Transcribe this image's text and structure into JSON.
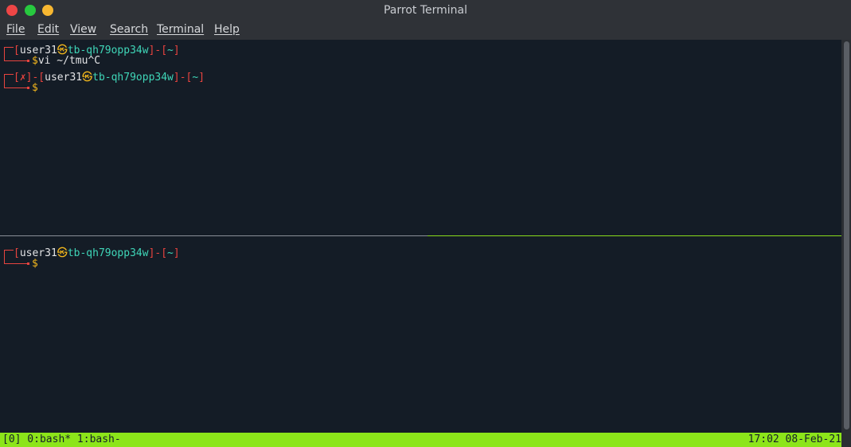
{
  "window": {
    "title": "Parrot Terminal"
  },
  "menu": {
    "items": [
      "File",
      "Edit",
      "View",
      "Search",
      "Terminal",
      "Help"
    ]
  },
  "top_pane": {
    "prompt1": {
      "open": "[",
      "user": "user31",
      "at": "㉿",
      "host": "tb-qh79opp34w",
      "mid": "]-[",
      "dir": "~",
      "close": "]"
    },
    "command1": {
      "symbol": "$",
      "text": "vi ~/tmu^C"
    },
    "prompt2": {
      "open": "[",
      "status": "✗",
      "close_status": "]-[",
      "user": "user31",
      "at": "㉿",
      "host": "tb-qh79opp34w",
      "mid": "]-[",
      "dir": "~",
      "close": "]"
    },
    "command2": {
      "symbol": "$"
    }
  },
  "bottom_pane": {
    "prompt": {
      "open": "[",
      "user": "user31",
      "at": "㉿",
      "host": "tb-qh79opp34w",
      "mid": "]-[",
      "dir": "~",
      "close": "]"
    },
    "command": {
      "symbol": "$"
    }
  },
  "statusbar": {
    "left": "[0] 0:bash* 1:bash-",
    "right": "17:02 08-Feb-21"
  },
  "colors": {
    "terminal_bg": "#141c26",
    "prompt_red": "#e8443f",
    "host_teal": "#3fd6b8",
    "accent_yellow": "#f4b81c",
    "status_green": "#8ce51a"
  }
}
